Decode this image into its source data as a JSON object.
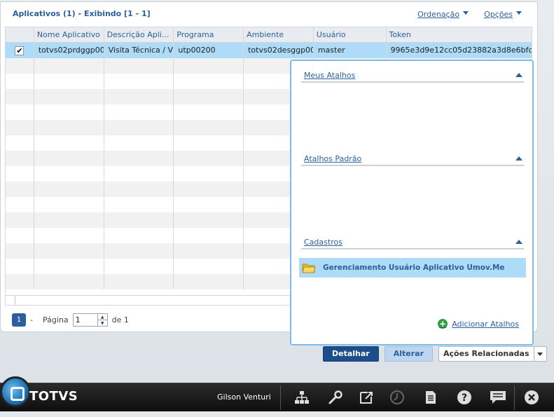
{
  "panel": {
    "title": "Aplicativos (1) - Exibindo [1 - 1]",
    "sort_label": "Ordenação",
    "options_label": "Opções"
  },
  "grid": {
    "columns": [
      "Nome Aplicativo",
      "Descrição Apli...",
      "Programa",
      "Ambiente",
      "Usuário",
      "Token"
    ],
    "rows": [
      {
        "checked": true,
        "cells": [
          "totvs02prdggp00",
          "Visita Técnica / V",
          "utp00200",
          "totvs02desggp00",
          "master",
          "9965e3d9e12cc05d23882a3d8e6bfc"
        ]
      }
    ]
  },
  "pager": {
    "current": "1",
    "separator": "-",
    "page_label": "Página",
    "page_value": "1",
    "of_label": "de 1"
  },
  "shortcuts_popup": {
    "sections": [
      {
        "title": "Meus Atalhos"
      },
      {
        "title": "Atalhos Padrão"
      },
      {
        "title": "Cadastros"
      }
    ],
    "item_label": "Gerenciamento Usuário Aplicativo Umov.Me",
    "add_label": "Adicionar Atalhos"
  },
  "actions": {
    "detail": "Detalhar",
    "edit": "Alterar",
    "related": "Ações Relacionadas"
  },
  "taskbar": {
    "brand": "TOTVS",
    "user": "Gilson Venturi",
    "icons": [
      "sitemap-icon",
      "wrench-icon",
      "external-window-icon",
      "clock-icon",
      "document-icon",
      "help-icon",
      "chat-icon",
      "close-icon"
    ]
  },
  "colors": {
    "accent": "#2c5f9e",
    "selected_row": "#aedbf7",
    "primary_button": "#1b4e8a"
  }
}
